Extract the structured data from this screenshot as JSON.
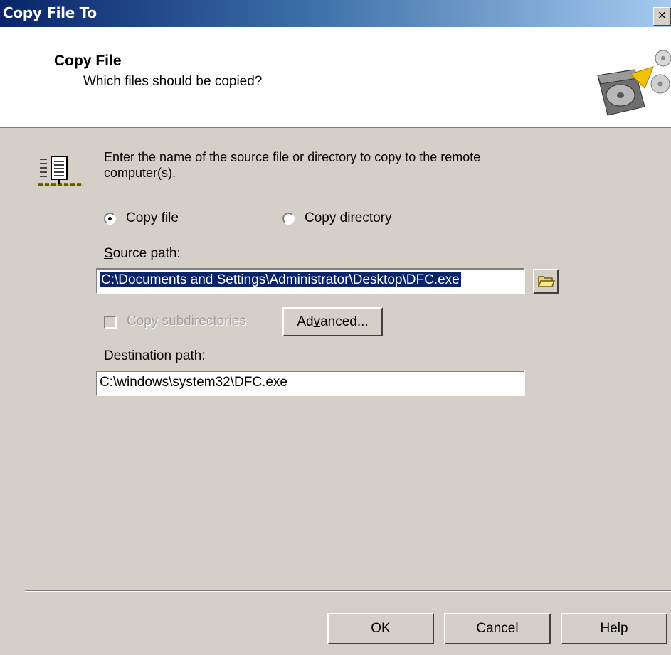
{
  "window": {
    "title": "Copy File To",
    "close_glyph": "×"
  },
  "header": {
    "title": "Copy File",
    "subtitle": "Which files should be copied?",
    "icon": "disk-copy-icon"
  },
  "intro": {
    "icon": "document-network-icon",
    "text": "Enter the name of the source file or directory to copy to the remote computer(s)."
  },
  "copy_mode": {
    "options": [
      {
        "pre": "Copy fil",
        "key": "e",
        "post": "",
        "checked": true
      },
      {
        "pre": "Copy ",
        "key": "d",
        "post": "irectory",
        "checked": false
      }
    ]
  },
  "source": {
    "label_key": "S",
    "label_rest": "ource path:",
    "value": "C:\\Documents and Settings\\Administrator\\Desktop\\DFC.exe",
    "browse_icon": "folder-open-icon"
  },
  "subdirs": {
    "label": "Copy subdirectories",
    "checked": false,
    "enabled": false
  },
  "advanced": {
    "pre": "Ad",
    "key": "v",
    "post": "anced..."
  },
  "destination": {
    "label_pre": "Des",
    "label_key": "t",
    "label_post": "ination path:",
    "value": "C:\\windows\\system32\\DFC.exe"
  },
  "buttons": {
    "ok": "OK",
    "cancel": "Cancel",
    "help": "Help"
  }
}
